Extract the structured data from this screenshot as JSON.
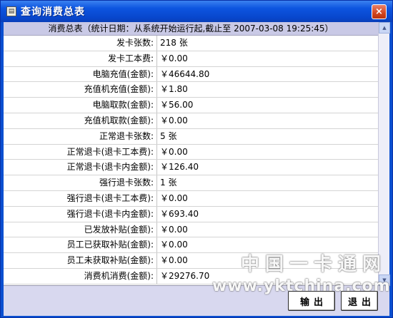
{
  "window": {
    "title": "查询消费总表",
    "close_glyph": "×"
  },
  "grid": {
    "header": "消费总表（统计日期：从系统开始运行起,截止至 2007-03-08 19:25:45）",
    "rows": [
      {
        "label": "发卡张数:",
        "value": "218 张"
      },
      {
        "label": "发卡工本费:",
        "value": "￥0.00"
      },
      {
        "label": "电脑充值(金额):",
        "value": "￥46644.80"
      },
      {
        "label": "充值机充值(金额):",
        "value": "￥1.80"
      },
      {
        "label": "电脑取款(金额):",
        "value": "￥56.00"
      },
      {
        "label": "充值机取款(金额):",
        "value": "￥0.00"
      },
      {
        "label": "正常退卡张数:",
        "value": "5 张"
      },
      {
        "label": "正常退卡(退卡工本费):",
        "value": "￥0.00"
      },
      {
        "label": "正常退卡(退卡内金额):",
        "value": "￥126.40"
      },
      {
        "label": "强行退卡张数:",
        "value": "1 张"
      },
      {
        "label": "强行退卡(退卡工本费):",
        "value": "￥0.00"
      },
      {
        "label": "强行退卡(退卡内金额):",
        "value": "￥693.40"
      },
      {
        "label": "已发放补贴(金额):",
        "value": "￥0.00"
      },
      {
        "label": "员工已获取补贴(金额):",
        "value": "￥0.00"
      },
      {
        "label": "员工未获取补贴(金额):",
        "value": "￥0.00"
      },
      {
        "label": "消费机消费(金额):",
        "value": "￥29276.70"
      }
    ]
  },
  "buttons": {
    "export_label": "输出",
    "exit_label": "退出"
  },
  "watermark": {
    "chinese": "中国一卡通网",
    "url": "www.yktchina.com"
  },
  "icons": {
    "title_icon": "form-icon",
    "close_icon": "close-icon",
    "scroll_up": "scroll-up-icon",
    "scroll_down": "scroll-down-icon"
  },
  "colors": {
    "titlebar": "#0a4fd0",
    "client_bg": "#d8d8ef",
    "header_bg": "#c9c9e6",
    "close_button": "#d2451f"
  }
}
